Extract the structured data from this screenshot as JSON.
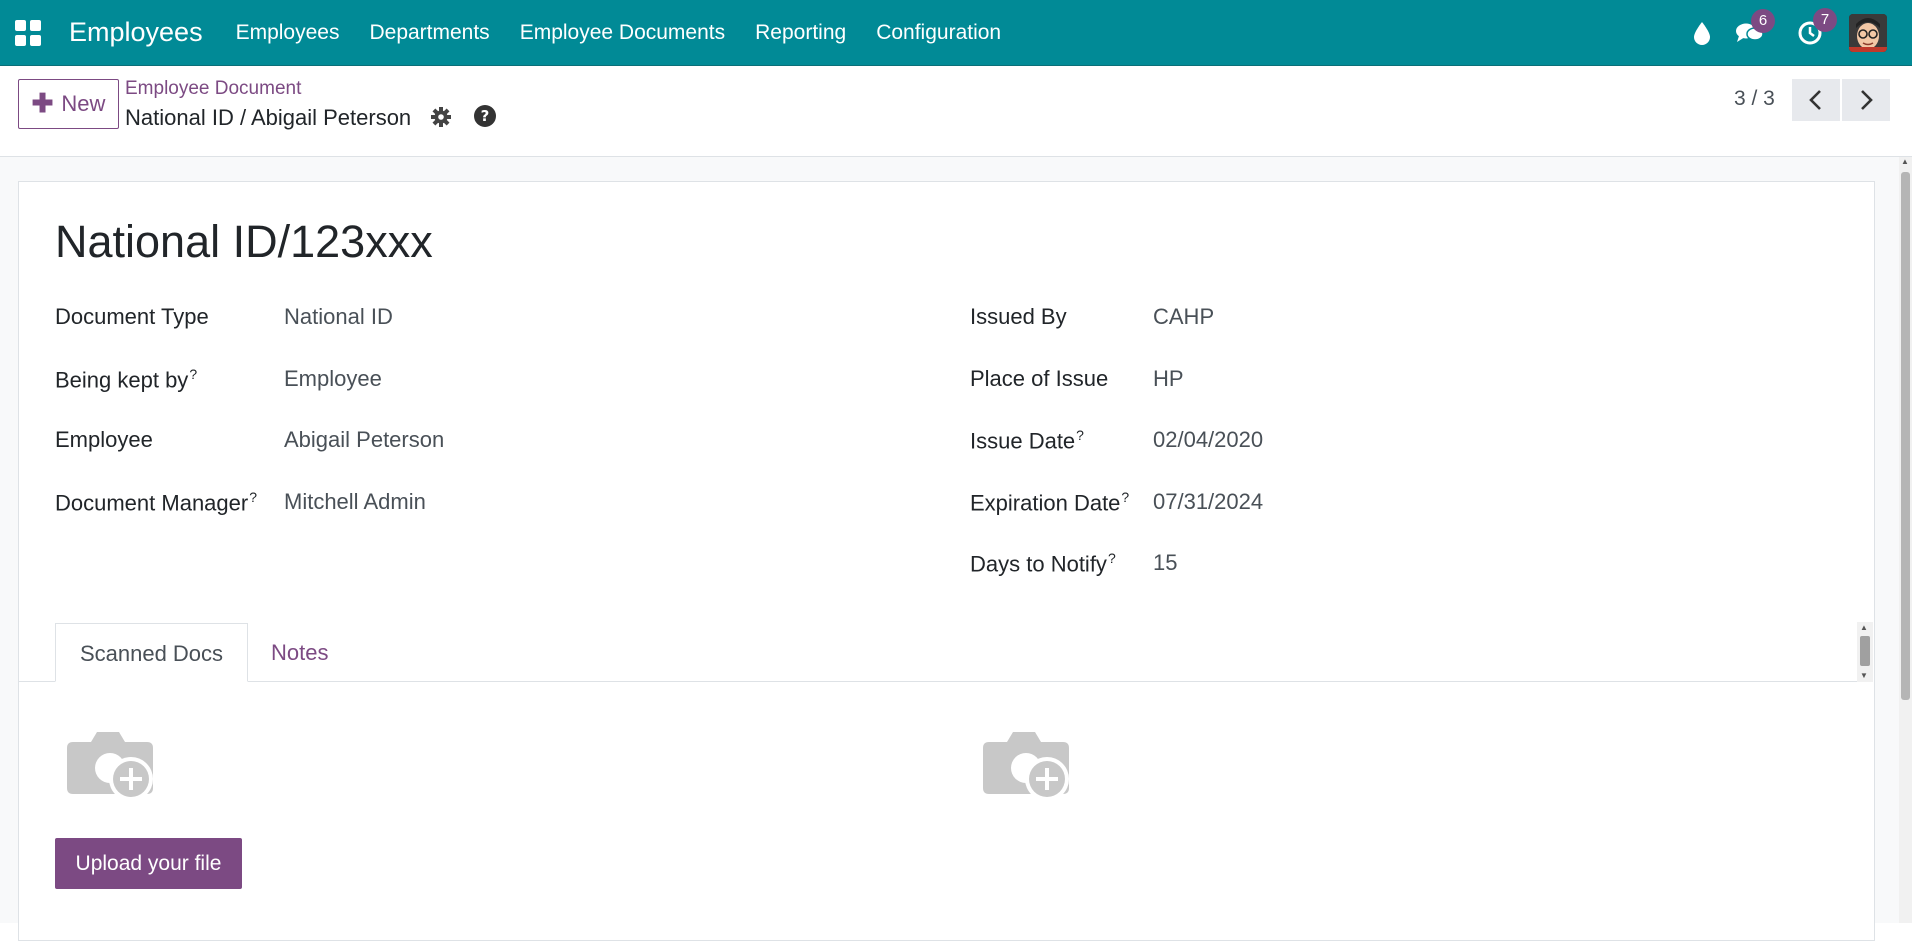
{
  "navbar": {
    "app_title": "Employees",
    "menu": [
      "Employees",
      "Departments",
      "Employee Documents",
      "Reporting",
      "Configuration"
    ],
    "messages_count": "6",
    "activities_count": "7"
  },
  "control_panel": {
    "new_label": "New",
    "breadcrumb_parent": "Employee Document",
    "breadcrumb_current": "National ID / Abigail Peterson",
    "pager": "3 / 3"
  },
  "record": {
    "title": "National ID/123xxx",
    "left_fields": [
      {
        "label": "Document Type",
        "help": "",
        "value": "National ID"
      },
      {
        "label": "Being kept by",
        "help": "?",
        "value": "Employee"
      },
      {
        "label": "Employee",
        "help": "",
        "value": "Abigail Peterson"
      },
      {
        "label": "Document Manager",
        "help": "?",
        "value": "Mitchell Admin"
      }
    ],
    "right_fields": [
      {
        "label": "Issued By",
        "help": "",
        "value": "CAHP"
      },
      {
        "label": "Place of Issue",
        "help": "",
        "value": "HP"
      },
      {
        "label": "Issue Date",
        "help": "?",
        "value": "02/04/2020"
      },
      {
        "label": "Expiration Date",
        "help": "?",
        "value": "07/31/2024"
      },
      {
        "label": "Days to Notify",
        "help": "?",
        "value": "15"
      }
    ]
  },
  "tabs": [
    "Scanned Docs",
    "Notes"
  ],
  "upload_label": "Upload your file",
  "colors": {
    "navbar": "#018a96",
    "accent": "#7c4a83",
    "badge": "#7c4a83"
  }
}
